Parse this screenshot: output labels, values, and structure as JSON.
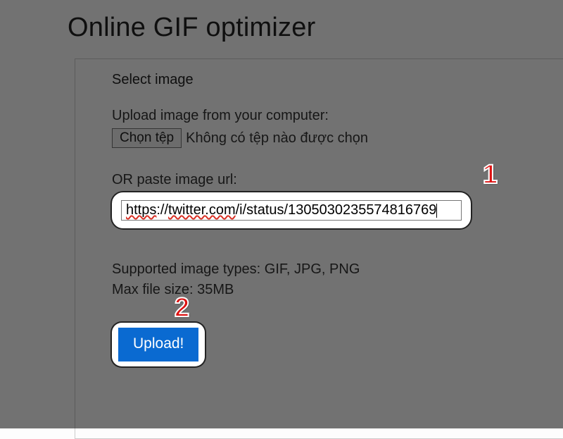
{
  "title": "Online GIF optimizer",
  "panel": {
    "legend": "Select image",
    "upload_label": "Upload image from your computer:",
    "file_button": "Chọn tệp",
    "file_status": "Không có tệp nào được chọn",
    "or_label": "OR paste image url:",
    "url_value": "https://twitter.com/i/status/1305030235574816769",
    "supported_types": "Supported image types: GIF, JPG, PNG",
    "max_size": "Max file size: 35MB",
    "upload_button": "Upload!"
  },
  "annotations": {
    "step1": "1",
    "step2": "2"
  }
}
